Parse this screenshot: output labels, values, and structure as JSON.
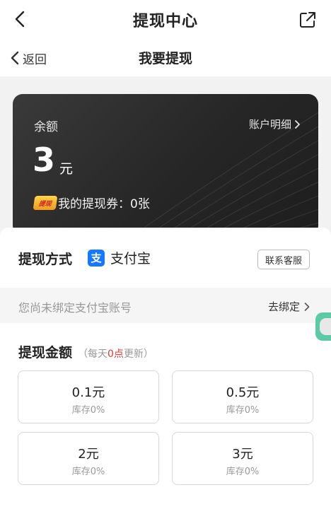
{
  "header": {
    "title": "提现中心"
  },
  "subheader": {
    "back_label": "返回",
    "title": "我要提现"
  },
  "balance_card": {
    "label": "余额",
    "detail_link": "账户明细",
    "amount": "3",
    "unit": "元",
    "coupon_badge": "提现",
    "coupon_text": "我的提现券：0张"
  },
  "method": {
    "label": "提现方式",
    "provider_icon": "支",
    "provider": "支付宝",
    "service_button": "联系客服"
  },
  "bind": {
    "text": "您尚未绑定支付宝账号",
    "action": "去绑定"
  },
  "amount_section": {
    "title": "提现金额",
    "note_prefix": "（每天",
    "note_highlight": "0点",
    "note_suffix": "更新）",
    "options": [
      {
        "value": "0.1元",
        "stock": "库存0%"
      },
      {
        "value": "0.5元",
        "stock": "库存0%"
      },
      {
        "value": "2元",
        "stock": "库存0%"
      },
      {
        "value": "3元",
        "stock": "库存0%"
      }
    ]
  },
  "colors": {
    "accent_red": "#e8342c",
    "alipay_blue": "#1677ff",
    "card_dark": "#262626"
  }
}
